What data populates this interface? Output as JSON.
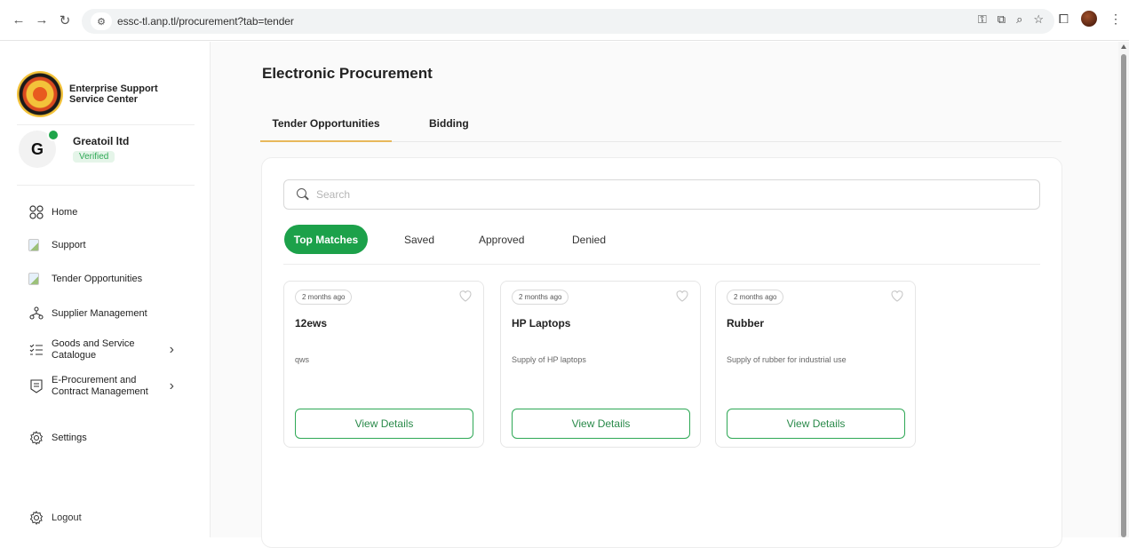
{
  "browser": {
    "url": "essc-tl.anp.tl/procurement?tab=tender",
    "back_icon": "arrow-left-icon",
    "forward_icon": "arrow-right-icon",
    "reload_icon": "reload-icon"
  },
  "sidebar": {
    "brand_name": "Enterprise Support Service Center",
    "user": {
      "initial": "G",
      "name": "Greatoil ltd",
      "status": "Verified"
    },
    "items": [
      {
        "label": "Home",
        "icon": "grid-icon"
      },
      {
        "label": "Support",
        "icon": "broken-image-icon"
      },
      {
        "label": "Tender Opportunities",
        "icon": "broken-image-icon"
      },
      {
        "label": "Supplier Management",
        "icon": "network-icon"
      },
      {
        "label": "Goods and Service Catalogue",
        "icon": "list-icon",
        "has_children": true
      },
      {
        "label": "E-Procurement and Contract Management",
        "icon": "document-icon",
        "has_children": true
      },
      {
        "label": "Settings",
        "icon": "gear-icon"
      }
    ],
    "logout_label": "Logout"
  },
  "main": {
    "title": "Electronic Procurement",
    "tabs": [
      {
        "label": "Tender Opportunities",
        "active": true
      },
      {
        "label": "Bidding",
        "active": false
      }
    ],
    "search_placeholder": "Search",
    "filters": [
      {
        "label": "Top Matches",
        "active": true
      },
      {
        "label": "Saved",
        "active": false
      },
      {
        "label": "Approved",
        "active": false
      },
      {
        "label": "Denied",
        "active": false
      }
    ],
    "cards": [
      {
        "age": "2 months ago",
        "title": "12ews",
        "description": "qws",
        "button": "View Details"
      },
      {
        "age": "2 months ago",
        "title": "HP Laptops",
        "description": "Supply of HP laptops",
        "button": "View Details"
      },
      {
        "age": "2 months ago",
        "title": "Rubber",
        "description": "Supply of rubber for industrial use",
        "button": "View Details"
      }
    ]
  },
  "colors": {
    "accent_green": "#1ca14a",
    "tab_underline": "#e8b85b"
  }
}
